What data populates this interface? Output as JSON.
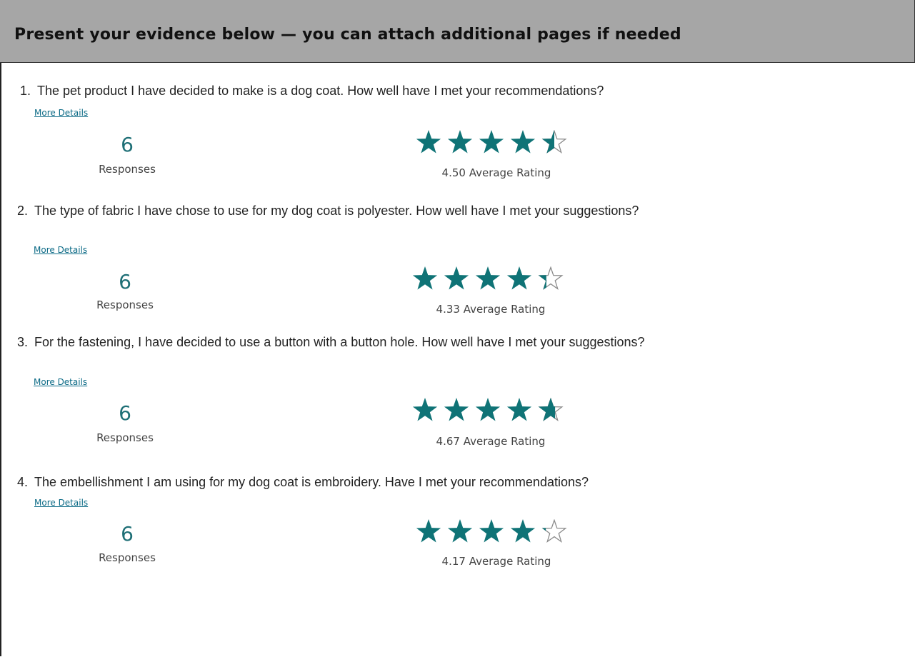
{
  "header": {
    "title": "Present your evidence below — you can attach additional pages if needed"
  },
  "colors": {
    "accent": "#0f7376",
    "star_empty": "#8a8a8a",
    "header_bg": "#a6a6a6"
  },
  "more_details_label": "More Details",
  "responses_label": "Responses",
  "questions": [
    {
      "number": "1.",
      "text": "The pet product I have decided to make is a dog coat. How well have I met your recommendations?",
      "responses": "6",
      "rating": 4.5,
      "rating_label": "4.50 Average Rating"
    },
    {
      "number": "2.",
      "text": "The type of fabric I have chose to use for my dog coat is polyester. How well have I met your suggestions?",
      "responses": "6",
      "rating": 4.33,
      "rating_label": "4.33 Average Rating"
    },
    {
      "number": "3.",
      "text": "For the fastening, I have decided to use a button with a button hole. How well have I met your suggestions?",
      "responses": "6",
      "rating": 4.67,
      "rating_label": "4.67 Average Rating"
    },
    {
      "number": "4.",
      "text": "The embellishment I am using for my dog coat is embroidery. Have I met your recommendations?",
      "responses": "6",
      "rating": 4.17,
      "rating_label": "4.17 Average Rating"
    }
  ]
}
